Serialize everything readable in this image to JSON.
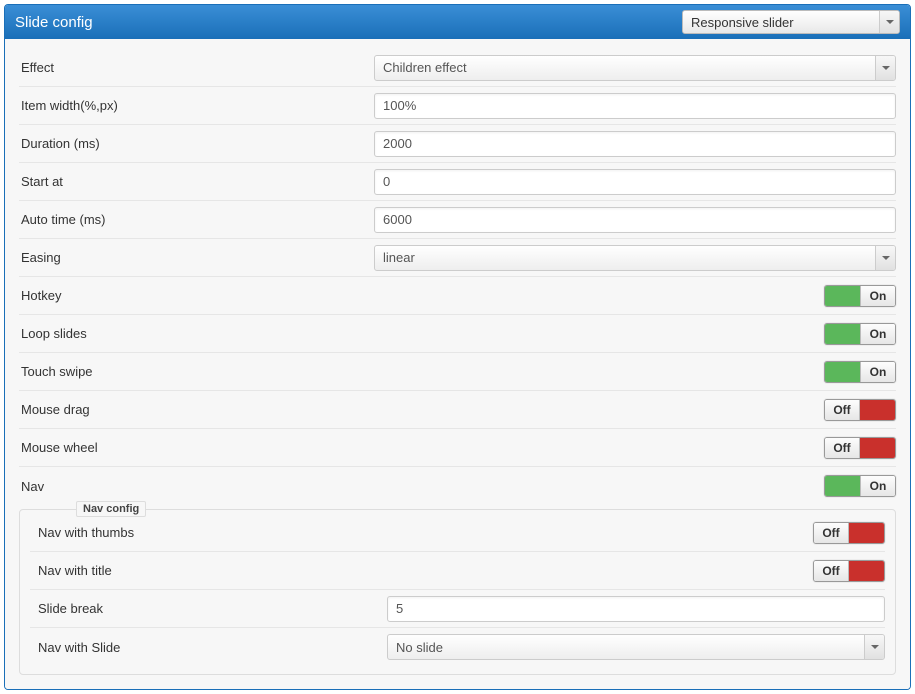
{
  "header": {
    "title": "Slide config",
    "slider_type": "Responsive slider"
  },
  "fields": {
    "effect_label": "Effect",
    "effect_value": "Children effect",
    "item_width_label": "Item width(%,px)",
    "item_width_value": "100%",
    "duration_label": "Duration (ms)",
    "duration_value": "2000",
    "start_at_label": "Start at",
    "start_at_value": "0",
    "auto_time_label": "Auto time (ms)",
    "auto_time_value": "6000",
    "easing_label": "Easing",
    "easing_value": "linear",
    "hotkey_label": "Hotkey",
    "hotkey_state": "On",
    "loop_label": "Loop slides",
    "loop_state": "On",
    "touch_label": "Touch swipe",
    "touch_state": "On",
    "mouse_drag_label": "Mouse drag",
    "mouse_drag_state": "Off",
    "mouse_wheel_label": "Mouse wheel",
    "mouse_wheel_state": "Off",
    "nav_label": "Nav",
    "nav_state": "On"
  },
  "nav_config": {
    "legend": "Nav config",
    "thumbs_label": "Nav with thumbs",
    "thumbs_state": "Off",
    "title_label": "Nav with title",
    "title_state": "Off",
    "slide_break_label": "Slide break",
    "slide_break_value": "5",
    "nav_with_slide_label": "Nav with Slide",
    "nav_with_slide_value": "No slide"
  },
  "toggle_labels": {
    "on": "On",
    "off": "Off"
  }
}
